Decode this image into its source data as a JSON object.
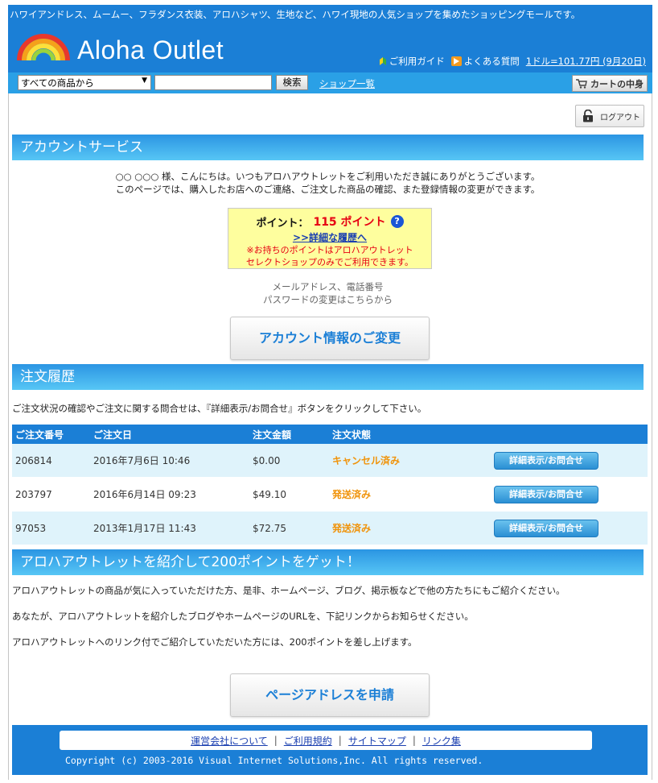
{
  "header": {
    "tagline": "ハワイアンドレス、ムームー、フラダンス衣装、アロハシャツ、生地など、ハワイ現地の人気ショップを集めたショッピングモールです。",
    "brand": "Aloha Outlet",
    "links": {
      "guide": "ご利用ガイド",
      "faq": "よくある質問",
      "rate": "1ドル=101.77円 (9月20日)"
    },
    "search": {
      "category": "すべての商品から",
      "query": "",
      "button": "検索",
      "shop_list": "ショップ一覧",
      "cart": "カートの中身"
    }
  },
  "logout": "ログアウト",
  "account": {
    "title": "アカウントサービス",
    "greeting": "○○ ○○○ 様、こんにちは。いつもアロハアウトレットをご利用いただき誠にありがとうございます。",
    "greeting2": "このページでは、購入したお店へのご連絡、ご注文した商品の確認、また登録情報の変更ができます。",
    "points_label": "ポイント：",
    "points_value": "115 ポイント",
    "points_link": ">>詳細な履歴へ",
    "points_note1": "※お持ちのポイントはアロハアウトレット",
    "points_note2": "セレクトショップのみでご利用できます。",
    "change_note1": "メールアドレス、電話番号",
    "change_note2": "パスワードの変更はこちらから",
    "change_button": "アカウント情報のご変更"
  },
  "orders": {
    "title": "注文履歴",
    "intro": "ご注文状況の確認やご注文に関する問合せは、『詳細表示/お問合せ』ボタンをクリックして下さい。",
    "columns": [
      "ご注文番号",
      "ご注文日",
      "注文金額",
      "注文状態"
    ],
    "rows": [
      {
        "number": "206814",
        "date": "2016年7月6日 10:46",
        "amount": "$0.00",
        "status": "キャンセル済み",
        "button": "詳細表示/お問合せ"
      },
      {
        "number": "203797",
        "date": "2016年6月14日 09:23",
        "amount": "$49.10",
        "status": "発送済み",
        "button": "詳細表示/お問合せ"
      },
      {
        "number": "97053",
        "date": "2013年1月17日 11:43",
        "amount": "$72.75",
        "status": "発送済み",
        "button": "詳細表示/お問合せ"
      }
    ]
  },
  "referral": {
    "title": "アロハアウトレットを紹介して200ポイントをゲット！",
    "p1": "アロハアウトレットの商品が気に入っていただけた方、是非、ホームページ、ブログ、掲示板などで他の方たちにもご紹介ください。",
    "p2": "あなたが、アロハアウトレットを紹介したブログやホームページのURLを、下記リンクからお知らせください。",
    "p3": "アロハアウトレットへのリンク付でご紹介していただいた方には、200ポイントを差し上げます。",
    "button": "ページアドレスを申請"
  },
  "footer": {
    "links": [
      "運営会社について",
      "ご利用規約",
      "サイトマップ",
      "リンク集"
    ],
    "copyright": "Copyright (c) 2003-2016 Visual Internet Solutions,Inc. All rights reserved."
  },
  "colors": {
    "header_blue": "#1b7fd6",
    "searchbar_blue": "#2aa0e6",
    "status_orange": "#f0930a",
    "point_red": "#e60012",
    "point_box_yellow": "#fefe9e"
  }
}
